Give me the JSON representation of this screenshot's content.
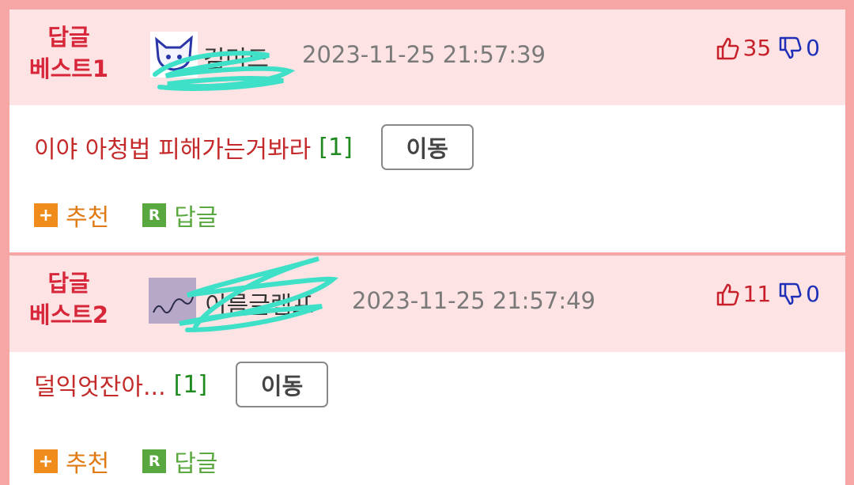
{
  "colors": {
    "background": "#f7a6a6",
    "header_bg": "#fde3e3",
    "best_label": "#d7263a",
    "title": "#c42a2a",
    "reply_count": "#1f8a1f",
    "up": "#c8202a",
    "down": "#1f2fb8",
    "recommend": "#e07a12",
    "reply": "#5aa83f",
    "scribble": "#3fe0c8"
  },
  "posts": [
    {
      "best_label_line1": "답글",
      "best_label_line2": "베스트1",
      "avatar_icon": "cat-avatar-icon",
      "nickname": "김미드",
      "date": "2023-11-25 21:57:39",
      "upvotes": "35",
      "downvotes": "0",
      "title": "이야 아청법 피해가는거봐라",
      "reply_count": "[1]",
      "move_label": "이동",
      "recommend_label": "추천",
      "reply_label": "답글"
    },
    {
      "best_label_line1": "답글",
      "best_label_line2": "베스트2",
      "avatar_icon": "text-avatar-icon",
      "nickname": "이름글램프",
      "date": "2023-11-25 21:57:49",
      "upvotes": "11",
      "downvotes": "0",
      "title": "덜익엇잔아...",
      "reply_count": "[1]",
      "move_label": "이동",
      "recommend_label": "추천",
      "reply_label": "답글"
    }
  ]
}
